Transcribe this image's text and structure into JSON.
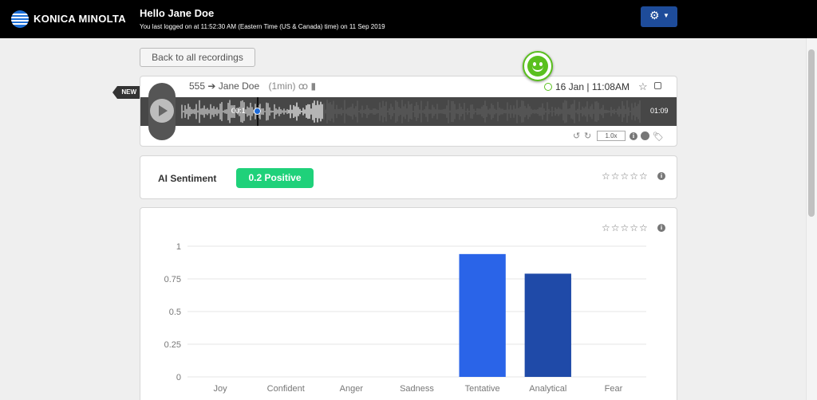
{
  "header": {
    "brand": "KONICA MINOLTA",
    "greeting": "Hello Jane Doe",
    "last_login": "You last logged on at 11:52:30 AM (Eastern Time (US & Canada) time) on 11 Sep 2019",
    "settings_icon": "gear-icon"
  },
  "nav": {
    "back_label": "Back to all recordings"
  },
  "recording": {
    "new_tag": "NEW",
    "from": "555",
    "to": "Jane Doe",
    "duration": "(1min)",
    "date": "16 Jan | 11:08AM",
    "current_time": "00:1",
    "end_time": "01:09",
    "played_fraction": 0.23,
    "speed": "1.0x"
  },
  "sentiment": {
    "label": "AI Sentiment",
    "badge": "0.2 Positive",
    "accent": "#1fd17a"
  },
  "chart_data": {
    "type": "bar",
    "categories": [
      "Joy",
      "Confident",
      "Anger",
      "Sadness",
      "Tentative",
      "Analytical",
      "Fear"
    ],
    "values": [
      0,
      0,
      0,
      0,
      0.94,
      0.79,
      0
    ],
    "ylim": [
      0,
      1
    ],
    "yticks": [
      0,
      0.25,
      0.5,
      0.75,
      1
    ],
    "ytick_labels": [
      "0",
      "0.25",
      "0.5",
      "0.75",
      "1"
    ],
    "colors": [
      "#2a64e8",
      "#2a64e8",
      "#2a64e8",
      "#2a64e8",
      "#2a64e8",
      "#1f4aa8",
      "#2a64e8"
    ],
    "grid": true
  }
}
